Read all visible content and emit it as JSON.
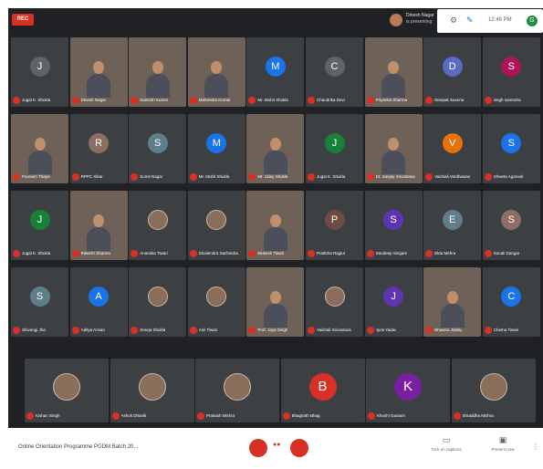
{
  "app": {
    "rec_label": "REC",
    "presenter_name": "Dinesh Nagar",
    "presenter_sub": "is presenting",
    "clock": "12:48 PM",
    "me_initial": "G"
  },
  "colors": {
    "background": "#202124",
    "tile": "#3c4043",
    "accent_red": "#d93025",
    "text": "#ffffff"
  },
  "participants": [
    {
      "name": "Jugal K. Shukla",
      "initial": "J",
      "color": "#5f6368",
      "type": "letter"
    },
    {
      "name": "Dinesh Nagar",
      "initial": "",
      "color": "#6e6258",
      "type": "video"
    },
    {
      "name": "Santosh Kumar",
      "initial": "",
      "color": "#6e6258",
      "type": "video"
    },
    {
      "name": "Mahendra Kumar",
      "initial": "",
      "color": "#6e6258",
      "type": "video"
    },
    {
      "name": "Mr. Mohit Shukla",
      "initial": "M",
      "color": "#1a73e8",
      "type": "letter"
    },
    {
      "name": "Chandrika Devi",
      "initial": "C",
      "color": "#5f6368",
      "type": "letter"
    },
    {
      "name": "Priyanka Sharma",
      "initial": "",
      "color": "#6e6258",
      "type": "video"
    },
    {
      "name": "Deepak Saxena",
      "initial": "D",
      "color": "#5c6bc0",
      "type": "letter"
    },
    {
      "name": "singh surendra",
      "initial": "S",
      "color": "#ad1457",
      "type": "letter"
    },
    {
      "name": "Poonam Thapa",
      "initial": "",
      "color": "#6e6258",
      "type": "video"
    },
    {
      "name": "RPPC Sikar",
      "initial": "R",
      "color": "#8d6e63",
      "type": "letter"
    },
    {
      "name": "Sumit Nagar",
      "initial": "S",
      "color": "#607d8b",
      "type": "letter"
    },
    {
      "name": "Mr. Mohit Shukla",
      "initial": "M",
      "color": "#1a73e8",
      "type": "letter"
    },
    {
      "name": "Mr. Uday Shukla",
      "initial": "",
      "color": "#6e6258",
      "type": "video"
    },
    {
      "name": "Jugal K. Shukla",
      "initial": "J",
      "color": "#188038",
      "type": "letter"
    },
    {
      "name": "Dr. Sanjay Srivastava",
      "initial": "",
      "color": "#6e6258",
      "type": "video"
    },
    {
      "name": "Vaishali Vardhawan",
      "initial": "V",
      "color": "#e8710a",
      "type": "letter"
    },
    {
      "name": "Shweta Agarwal",
      "initial": "S",
      "color": "#1a73e8",
      "type": "letter"
    },
    {
      "name": "Jugal K. Shukla",
      "initial": "J",
      "color": "#188038",
      "type": "letter"
    },
    {
      "name": "Rakesh Sharma",
      "initial": "",
      "color": "#6e6258",
      "type": "video"
    },
    {
      "name": "Anamika Tiwari",
      "initial": "",
      "color": "#3c4043",
      "type": "photo"
    },
    {
      "name": "Shailendra Sachindra",
      "initial": "",
      "color": "#3c4043",
      "type": "photo"
    },
    {
      "name": "Mukesh Tiwari",
      "initial": "",
      "color": "#6e6258",
      "type": "video"
    },
    {
      "name": "Pratibha Rajput",
      "initial": "P",
      "color": "#6d4c41",
      "type": "letter"
    },
    {
      "name": "Sandeep Singare",
      "initial": "S",
      "color": "#5e35b1",
      "type": "letter"
    },
    {
      "name": "Ekta Mehra",
      "initial": "E",
      "color": "#607d8b",
      "type": "letter"
    },
    {
      "name": "Sonali Dangar",
      "initial": "S",
      "color": "#8d6e63",
      "type": "letter"
    },
    {
      "name": "Shivangi Jha",
      "initial": "S",
      "color": "#607d8b",
      "type": "letter"
    },
    {
      "name": "Aditya Ansari",
      "initial": "A",
      "color": "#1a73e8",
      "type": "letter"
    },
    {
      "name": "Sreeja Shukla",
      "initial": "",
      "color": "#3c4043",
      "type": "photo"
    },
    {
      "name": "Anil Tiwari",
      "initial": "",
      "color": "#3c4043",
      "type": "photo"
    },
    {
      "name": "Prof. Jaya Singh",
      "initial": "",
      "color": "#6e6258",
      "type": "video"
    },
    {
      "name": "Vaishali Srivastava",
      "initial": "",
      "color": "#3c4043",
      "type": "photo"
    },
    {
      "name": "Jyoti Yadav",
      "initial": "J",
      "color": "#5e35b1",
      "type": "letter"
    },
    {
      "name": "Bhawna Jaitley",
      "initial": "",
      "color": "#6e6258",
      "type": "video"
    },
    {
      "name": "Chetna Tiwari",
      "initial": "C",
      "color": "#1a73e8",
      "type": "letter"
    }
  ],
  "bottom_row": [
    {
      "name": "Kishan Singh",
      "initial": "",
      "color": "#3c4043",
      "type": "photo"
    },
    {
      "name": "Ashok Dhanik",
      "initial": "",
      "color": "#3c4043",
      "type": "photo"
    },
    {
      "name": "Prakash Mishra",
      "initial": "",
      "color": "#3c4043",
      "type": "photo"
    },
    {
      "name": "Bhagirath Bhag",
      "initial": "B",
      "color": "#d93025",
      "type": "letter"
    },
    {
      "name": "Khushi Gautam",
      "initial": "K",
      "color": "#7b1fa2",
      "type": "letter"
    },
    {
      "name": "Shraddha Mishra",
      "initial": "",
      "color": "#3c4043",
      "type": "photo"
    }
  ],
  "bottom_bar": {
    "meeting_title": "Online Orientation Programme PGDM Batch 20...",
    "captions_label": "Turn on captions",
    "present_label": "Present now"
  }
}
